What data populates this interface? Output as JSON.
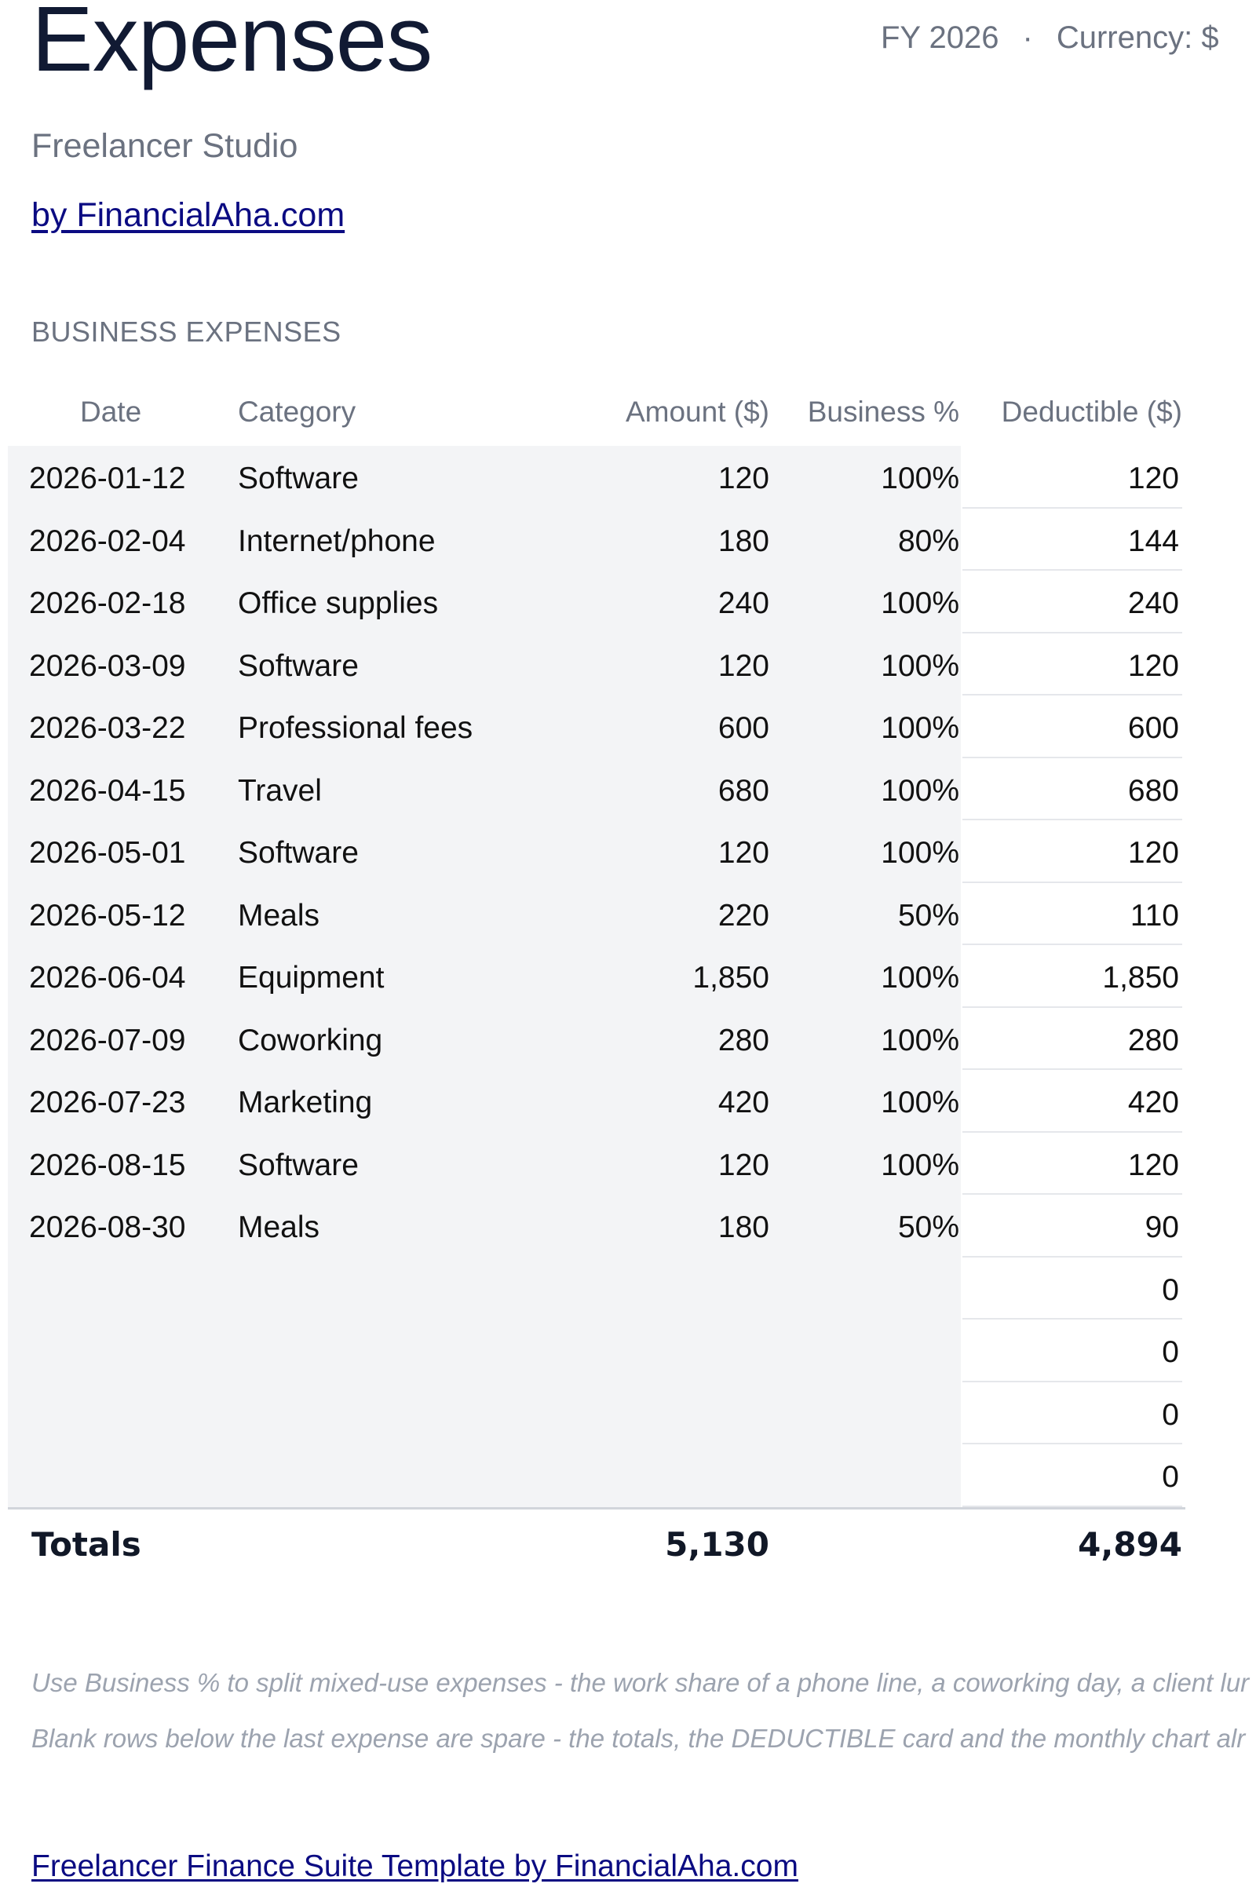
{
  "header": {
    "title": "Expenses",
    "fiscal_year": "FY 2026",
    "separator": "·",
    "currency": "Currency: $",
    "subtitle": "Freelancer Studio",
    "byline": "by FinancialAha.com"
  },
  "section": {
    "label": "BUSINESS EXPENSES"
  },
  "table": {
    "columns": {
      "date": "Date",
      "category": "Category",
      "amount": "Amount ($)",
      "business_pct": "Business %",
      "deductible": "Deductible ($)"
    },
    "rows": [
      {
        "date": "2026-01-12",
        "category": "Software",
        "amount": "120",
        "business_pct": "100%",
        "deductible": "120"
      },
      {
        "date": "2026-02-04",
        "category": "Internet/phone",
        "amount": "180",
        "business_pct": "80%",
        "deductible": "144"
      },
      {
        "date": "2026-02-18",
        "category": "Office supplies",
        "amount": "240",
        "business_pct": "100%",
        "deductible": "240"
      },
      {
        "date": "2026-03-09",
        "category": "Software",
        "amount": "120",
        "business_pct": "100%",
        "deductible": "120"
      },
      {
        "date": "2026-03-22",
        "category": "Professional fees",
        "amount": "600",
        "business_pct": "100%",
        "deductible": "600"
      },
      {
        "date": "2026-04-15",
        "category": "Travel",
        "amount": "680",
        "business_pct": "100%",
        "deductible": "680"
      },
      {
        "date": "2026-05-01",
        "category": "Software",
        "amount": "120",
        "business_pct": "100%",
        "deductible": "120"
      },
      {
        "date": "2026-05-12",
        "category": "Meals",
        "amount": "220",
        "business_pct": "50%",
        "deductible": "110"
      },
      {
        "date": "2026-06-04",
        "category": "Equipment",
        "amount": "1,850",
        "business_pct": "100%",
        "deductible": "1,850"
      },
      {
        "date": "2026-07-09",
        "category": "Coworking",
        "amount": "280",
        "business_pct": "100%",
        "deductible": "280"
      },
      {
        "date": "2026-07-23",
        "category": "Marketing",
        "amount": "420",
        "business_pct": "100%",
        "deductible": "420"
      },
      {
        "date": "2026-08-15",
        "category": "Software",
        "amount": "120",
        "business_pct": "100%",
        "deductible": "120"
      },
      {
        "date": "2026-08-30",
        "category": "Meals",
        "amount": "180",
        "business_pct": "50%",
        "deductible": "90"
      },
      {
        "date": "",
        "category": "",
        "amount": "",
        "business_pct": "",
        "deductible": "0"
      },
      {
        "date": "",
        "category": "",
        "amount": "",
        "business_pct": "",
        "deductible": "0"
      },
      {
        "date": "",
        "category": "",
        "amount": "",
        "business_pct": "",
        "deductible": "0"
      },
      {
        "date": "",
        "category": "",
        "amount": "",
        "business_pct": "",
        "deductible": "0"
      }
    ],
    "totals": {
      "label": "Totals",
      "amount": "5,130",
      "deductible": "4,894"
    }
  },
  "notes": {
    "line1": "Use Business % to split mixed-use expenses - the work share of a phone line, a coworking day, a client lur",
    "line2": "Blank rows below the last expense are spare - the totals, the DEDUCTIBLE card and the monthly chart alr"
  },
  "footer": {
    "link": "Freelancer Finance Suite Template by FinancialAha.com"
  }
}
